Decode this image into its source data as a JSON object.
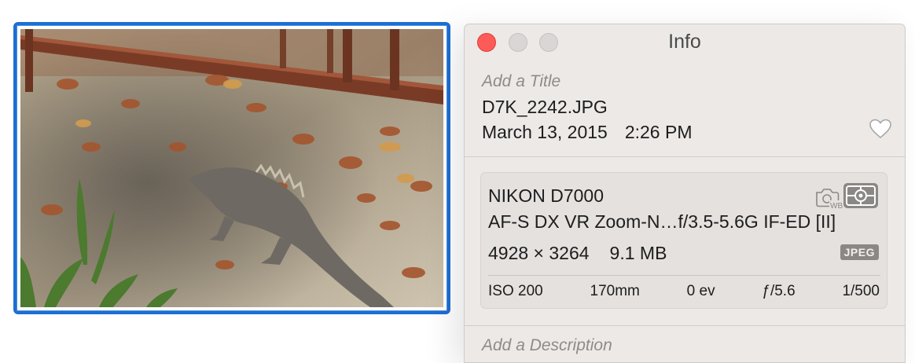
{
  "window": {
    "title": "Info"
  },
  "info": {
    "title_placeholder": "Add a Title",
    "filename": "D7K_2242.JPG",
    "date": "March 13, 2015",
    "time": "2:26 PM",
    "favorite_icon": "heart-outline-icon",
    "description_placeholder": "Add a Description"
  },
  "exif": {
    "camera": "NIKON D7000",
    "lens": "AF-S DX VR Zoom-N…f/3.5-5.6G IF-ED [II]",
    "dimensions": "4928 × 3264",
    "file_size": "9.1 MB",
    "format_badge": "JPEG",
    "white_balance_icon": "camera-wb-icon",
    "metering_icon": "spot-metering-icon",
    "iso": "ISO 200",
    "focal_length": "170mm",
    "exposure_bias": "0 ev",
    "aperture": "ƒ/5.6",
    "shutter_speed": "1/500"
  },
  "colors": {
    "selection": "#1d6fd2",
    "close_button": "#fc5b57",
    "window_bg": "#ece9e7"
  }
}
